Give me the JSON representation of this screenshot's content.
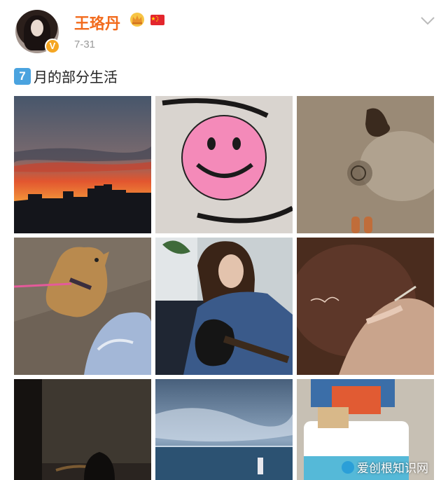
{
  "post": {
    "username": "王珞丹",
    "date": "7-31",
    "text": "月的部分生活",
    "keycap_number": "7",
    "verified_badge": "V"
  },
  "images": [
    {
      "name": "sunset-skyline-photo"
    },
    {
      "name": "smiley-sand-photo"
    },
    {
      "name": "shell-sand-photo"
    },
    {
      "name": "shiba-dog-photo"
    },
    {
      "name": "guitar-woman-photo"
    },
    {
      "name": "writing-hand-photo"
    },
    {
      "name": "dark-window-silhouette-photo"
    },
    {
      "name": "lake-clouds-photo"
    },
    {
      "name": "toy-bus-photo"
    }
  ],
  "watermark": {
    "text": "爱创根知识网"
  },
  "colors": {
    "username": "#f26b1d",
    "date": "#999999",
    "keycap": "#4aa3df"
  }
}
